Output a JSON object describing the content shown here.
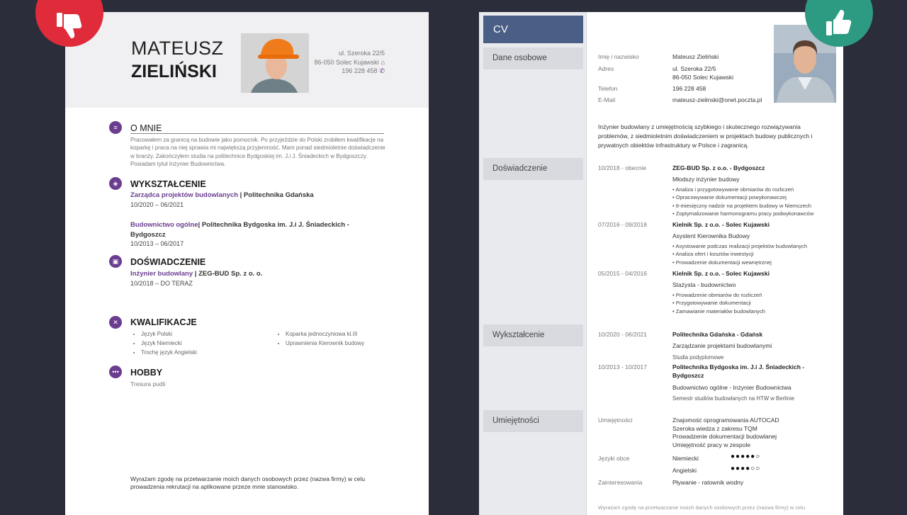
{
  "left_cv": {
    "first_name": "MATEUSZ",
    "last_name": "ZIELIŃSKI",
    "address_line1": "ul. Szeroka 22/5",
    "address_line2": "86-050 Solec Kujawski",
    "phone": "196 228 458",
    "about": {
      "title": "O MNIE",
      "text": "Pracowałem za granicą na budowie jako pomocnik. Po przyjeździe do Polski zrobiłem kwalifikacje na koparkę i praca na niej sprawia mi największą przyjemność. Mam ponad siedmioletnie doświadczenie w branży. Zakończyłem studia na politechnice Bydgoskiej im. J.i J. Śniadeckich w Bydgoszczy. Posiadam tytuł Inżynier Budownictwa."
    },
    "education": {
      "title": "WYKSZTAŁCENIE",
      "entries": [
        {
          "field": "Zarządca projektów budowlanych",
          "school": " | Politechnika Gdańska",
          "dates": "10/2020 – 06/2021"
        },
        {
          "field": "Budownictwo ogólne",
          "school": "| Politechnika Bydgoska im. J.i J. Śniadeckich - Bydgoszcz",
          "dates": "10/2013 – 06/2017"
        }
      ]
    },
    "experience": {
      "title": "DOŚWIADCZENIE",
      "role": "Inżynier budowlany",
      "company": " | ZEG-BUD Sp. z o. o.",
      "dates": "10/2018 – DO TERAZ"
    },
    "skills": {
      "title": "KWALIFIKACJE",
      "col1": [
        "Język Polski",
        "Język Niemiecki",
        "Trochę język Angielski"
      ],
      "col2": [
        "Koparka jednoczyniowa kl.III",
        "Uprawnienia Kierownik budowy"
      ]
    },
    "hobby": {
      "title": "HOBBY",
      "text": "Tresura pudli"
    },
    "consent": "Wyrażam zgodę na przetwarzanie moich danych osobowych przez (nazwa firmy) w celu prowadzenia rekrutacji na aplikowane przeze mnie stanowisko."
  },
  "right_cv": {
    "header": "CV",
    "sections": {
      "personal": "Dane osobowe",
      "experience": "Doświadczenie",
      "education": "Wykształcenie",
      "skills": "Umiejętności"
    },
    "personal": {
      "name_label": "Imię i nazwisko",
      "name": "Mateusz Zieliński",
      "address_label": "Adres",
      "address_line1": "ul. Szeroka 22/5",
      "address_line2": "86-050 Solec Kujawski",
      "phone_label": "Telefon",
      "phone": "196 228 458",
      "email_label": "E-Mail",
      "email": "mateusz-zielinski@onet.poczta.pl"
    },
    "summary": "Inżynier budowlany z umiejętnością szybkiego i skutecznego rozwiązywania problemów, z siedmioletnim doświadczeniem w projektach budowy publicznych i prywatnych obiektów infrastruktury w Polsce i zagranicą.",
    "jobs": [
      {
        "dates": "10/2018 - obecnie",
        "company": "ZEG-BUD Sp. z o.o. - Bydgoszcz",
        "role": "Młodszy inżynier budowy",
        "duties": [
          "Analiza i przygotowywanie obmiarów do rozliczeń",
          "Opracowywanie dokumentacji powykonawczej",
          "8-miesięczny nadzór na projektem budowy w Niemczech",
          "Zoptymalizowanie harmonogramu pracy podwykonawców"
        ]
      },
      {
        "dates": "07/2016 - 09/2018",
        "company": "Kielnik Sp. z o.o. - Solec Kujawski",
        "role": "Asystent Kierownika Budowy",
        "duties": [
          "Asystowanie podczas realizacji projektów budowlanych",
          "Analiza ofert i kosztów inwestycji",
          "Prowadzenie dokumentacji wewnętrznej"
        ]
      },
      {
        "dates": "05/2015 - 04/2016",
        "company": "Kielnik Sp. z o.o. - Solec Kujawski",
        "role": "Stażysta - budownictwo",
        "duties": [
          "Prowadzenie obmiarów do rozliczeń",
          "Przygotowywanie dokumentacji",
          "Zamawianie materiałów budowlanych"
        ]
      }
    ],
    "schools": [
      {
        "dates": "10/2020 - 06/2021",
        "school": "Politechnika Gdańska - Gdańsk",
        "field": "Zarządzanie projektami budowlanymi",
        "note": "Studia podyplomowe"
      },
      {
        "dates": "10/2013 - 10/2017",
        "school_line1": "Politechnika Bydgoska im. J.i J. Śniadeckich -",
        "school_line2": "Bydgoszcz",
        "field": "Budownictwo ogólne - Inżynier Budownictwa",
        "note": "Semestr studiów budowlanych na HTW w Berlinie"
      }
    ],
    "skills": {
      "label": "Umiejętności",
      "items": [
        "Znajomość oprogramowania AUTOCAD",
        "Szeroka wiedza z zakresu TQM",
        "Prowadzenie dokumentacji budowlanej",
        "Umiejętność pracy w zespole"
      ],
      "languages_label": "Języki obce",
      "languages": [
        {
          "name": "Niemiecki",
          "level": 5,
          "max": 6
        },
        {
          "name": "Angielski",
          "level": 4,
          "max": 6
        }
      ],
      "interests_label": "Zainteresowania",
      "interests": "Pływanie - ratownik wodny"
    },
    "consent": "Wyrażam zgodę na przetwarzanie moich danych osobowych przez (nazwa firmy) w celu"
  },
  "badges": {
    "left": "thumbs-down-icon",
    "right": "thumbs-up-icon",
    "left_color": "#df2b3a",
    "right_color": "#2d9a82"
  },
  "accent_color": "#6a3d8f",
  "sidebar_header_color": "#4a5f86"
}
